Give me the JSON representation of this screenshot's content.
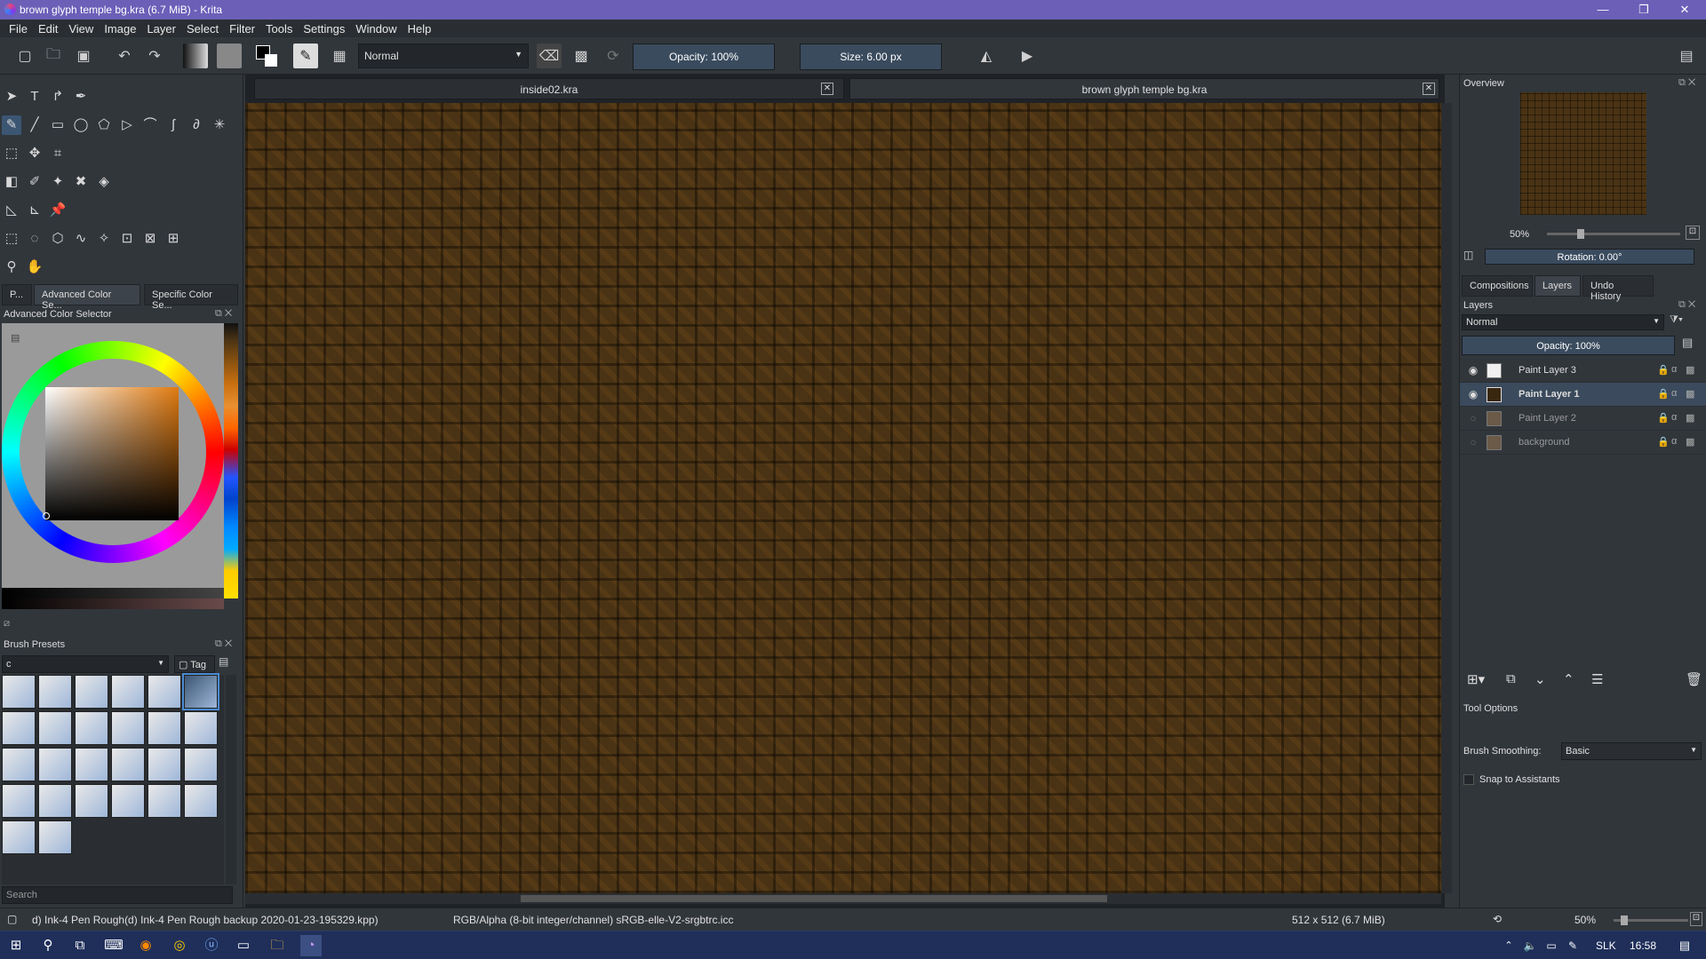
{
  "window": {
    "title": "brown glyph temple bg.kra (6.7 MiB)  - Krita",
    "minimize": "—",
    "maximize": "❐",
    "close": "✕"
  },
  "menu": [
    "File",
    "Edit",
    "View",
    "Image",
    "Layer",
    "Select",
    "Filter",
    "Tools",
    "Settings",
    "Window",
    "Help"
  ],
  "toolbar": {
    "blend_mode": "Normal",
    "opacity_label": "Opacity: 100%",
    "size_label": "Size: 6.00 px"
  },
  "left_tabs": [
    "P...",
    "Advanced Color Se...",
    "Specific Color Se..."
  ],
  "color_selector_title": "Advanced Color Selector",
  "brush_presets": {
    "title": "Brush Presets",
    "filter_value": "c",
    "tag_label": "Tag",
    "search_placeholder": "Search"
  },
  "documents": [
    {
      "name": "inside02.kra",
      "close": "✕"
    },
    {
      "name": "brown glyph temple bg.kra",
      "close": "✕"
    }
  ],
  "overview": {
    "title": "Overview",
    "zoom": "50%",
    "rotation": "Rotation: 0.00°"
  },
  "right_tabs": [
    "Compositions",
    "Layers",
    "Undo History"
  ],
  "layers_panel": {
    "title": "Layers",
    "blend_mode": "Normal",
    "opacity": "Opacity:  100%",
    "layers": [
      {
        "name": "Paint Layer 3",
        "visible": true,
        "selected": false
      },
      {
        "name": "Paint Layer 1",
        "visible": true,
        "selected": true
      },
      {
        "name": "Paint Layer 2",
        "visible": false,
        "selected": false
      },
      {
        "name": "background",
        "visible": false,
        "selected": false
      }
    ]
  },
  "tool_options": {
    "title": "Tool Options",
    "smoothing_label": "Brush Smoothing:",
    "smoothing_value": "Basic",
    "snap_label": "Snap to Assistants"
  },
  "status": {
    "preset": "d) Ink-4 Pen Rough(d) Ink-4 Pen Rough backup 2020-01-23-195329.kpp)",
    "color_profile": "RGB/Alpha (8-bit integer/channel)  sRGB-elle-V2-srgbtrc.icc",
    "image_size": "512 x 512 (6.7 MiB)",
    "zoom": "50%"
  },
  "taskbar": {
    "lang": "SLK",
    "time": "16:58"
  },
  "colors": {
    "accent": "#6b5fb8",
    "canvas_brown": "#4a3314",
    "selection": "#3b4a5c"
  }
}
